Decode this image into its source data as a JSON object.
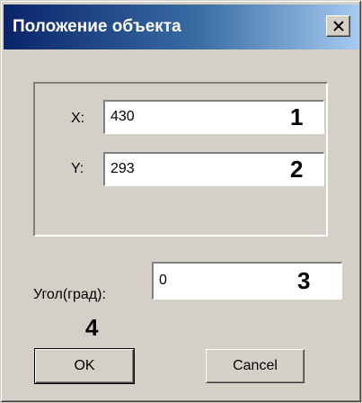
{
  "window": {
    "title": "Положение объекта",
    "close_icon": "close-icon"
  },
  "position": {
    "x_label": "X:",
    "x_value": "430",
    "y_label": "Y:",
    "y_value": "293"
  },
  "angle": {
    "label": "Угол(град):",
    "value": "0"
  },
  "buttons": {
    "ok_label": "OK",
    "cancel_label": "Cancel"
  },
  "markers": {
    "m1": "1",
    "m2": "2",
    "m3": "3",
    "m4": "4"
  },
  "colors": {
    "titlebar_start": "#0a246a",
    "titlebar_end": "#a6caf0",
    "dialog_bg": "#d4d0c8"
  }
}
